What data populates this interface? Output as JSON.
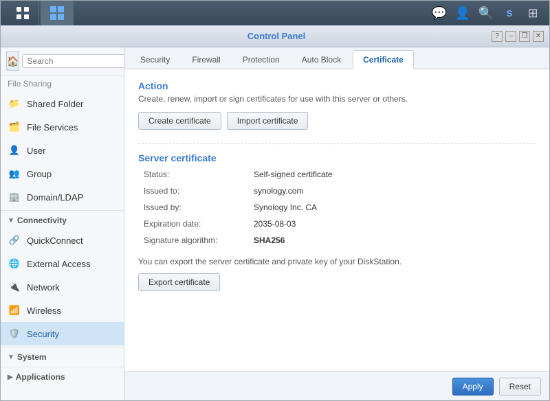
{
  "app": {
    "title": "Control Panel"
  },
  "topbar": {
    "icons": [
      "chat-icon",
      "user-icon",
      "search-icon",
      "synology-icon",
      "apps-icon"
    ]
  },
  "titlebar": {
    "title": "Control Panel",
    "help_label": "?",
    "minimize_label": "–",
    "restore_label": "❐",
    "close_label": "✕"
  },
  "sidebar": {
    "search_placeholder": "Search",
    "items": [
      {
        "label": "File Sharing",
        "icon": "folder-icon",
        "section": true
      },
      {
        "label": "Shared Folder",
        "icon": "shared-folder-icon"
      },
      {
        "label": "File Services",
        "icon": "file-services-icon"
      },
      {
        "label": "User",
        "icon": "user-icon"
      },
      {
        "label": "Group",
        "icon": "group-icon"
      },
      {
        "label": "Domain/LDAP",
        "icon": "domain-icon"
      },
      {
        "label": "Connectivity",
        "icon": "",
        "section": true
      },
      {
        "label": "QuickConnect",
        "icon": "quickconnect-icon"
      },
      {
        "label": "External Access",
        "icon": "external-icon"
      },
      {
        "label": "Network",
        "icon": "network-icon"
      },
      {
        "label": "Wireless",
        "icon": "wireless-icon"
      },
      {
        "label": "Security",
        "icon": "security-icon",
        "active": true
      },
      {
        "label": "System",
        "icon": "",
        "section": true
      },
      {
        "label": "Applications",
        "icon": "",
        "section": true
      }
    ]
  },
  "tabs": [
    {
      "label": "Security",
      "active": false
    },
    {
      "label": "Firewall",
      "active": false
    },
    {
      "label": "Protection",
      "active": false
    },
    {
      "label": "Auto Block",
      "active": false
    },
    {
      "label": "Certificate",
      "active": true
    }
  ],
  "content": {
    "action_title": "Action",
    "action_desc": "Create, renew, import or sign certificates for use with this server or others.",
    "create_btn": "Create certificate",
    "import_btn": "Import certificate",
    "server_cert_title": "Server certificate",
    "fields": [
      {
        "label": "Status:",
        "value": "Self-signed certificate",
        "class": "status-red"
      },
      {
        "label": "Issued to:",
        "value": "synology.com",
        "class": ""
      },
      {
        "label": "Issued by:",
        "value": "Synology Inc. CA",
        "class": ""
      },
      {
        "label": "Expiration date:",
        "value": "2035-08-03",
        "class": ""
      },
      {
        "label": "Signature algorithm:",
        "value": "SHA256",
        "class": "status-green"
      }
    ],
    "export_note": "You can export the server certificate and private key of your DiskStation.",
    "export_btn": "Export certificate"
  },
  "footer": {
    "apply_label": "Apply",
    "reset_label": "Reset"
  }
}
